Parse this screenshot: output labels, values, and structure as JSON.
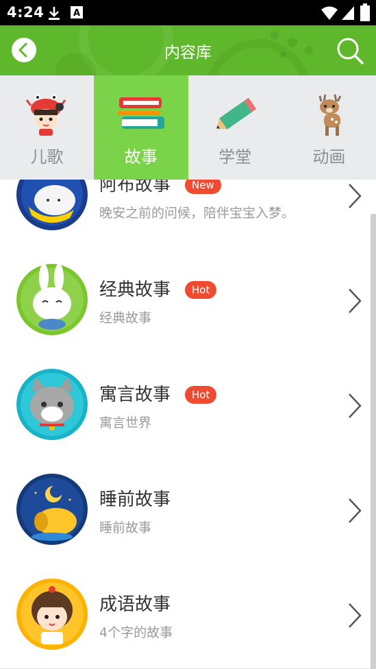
{
  "status_bar": {
    "time": "4:24",
    "icons": [
      "download-icon",
      "text-a-icon",
      "wifi-icon",
      "signal-icon",
      "battery-icon"
    ]
  },
  "header": {
    "title": "内容库",
    "back_icon": "chevron-left-icon",
    "search_icon": "search-icon",
    "color": "#5fb82b"
  },
  "tabs": [
    {
      "label": "儿歌",
      "icon": "girl-crab-hat-icon",
      "active": false
    },
    {
      "label": "故事",
      "icon": "books-icon",
      "active": true
    },
    {
      "label": "学堂",
      "icon": "pencil-icon",
      "active": false
    },
    {
      "label": "动画",
      "icon": "deer-icon",
      "active": false
    }
  ],
  "active_tab_color": "#7bd34a",
  "list": [
    {
      "title": "阿布故事",
      "badge": "New",
      "subtitle": "晚安之前的问候，陪伴宝宝入梦。",
      "avatar": "sleeping-bunny-avatar"
    },
    {
      "title": "经典故事",
      "badge": "Hot",
      "subtitle": "经典故事",
      "avatar": "white-rabbit-avatar"
    },
    {
      "title": "寓言故事",
      "badge": "Hot",
      "subtitle": "寓言世界",
      "avatar": "grey-cat-avatar"
    },
    {
      "title": "睡前故事",
      "badge": "",
      "subtitle": "睡前故事",
      "avatar": "sleeping-dog-moon-avatar"
    },
    {
      "title": "成语故事",
      "badge": "",
      "subtitle": "4个字的故事",
      "avatar": "girl-avatar"
    }
  ],
  "badge_color": "#f04b30"
}
